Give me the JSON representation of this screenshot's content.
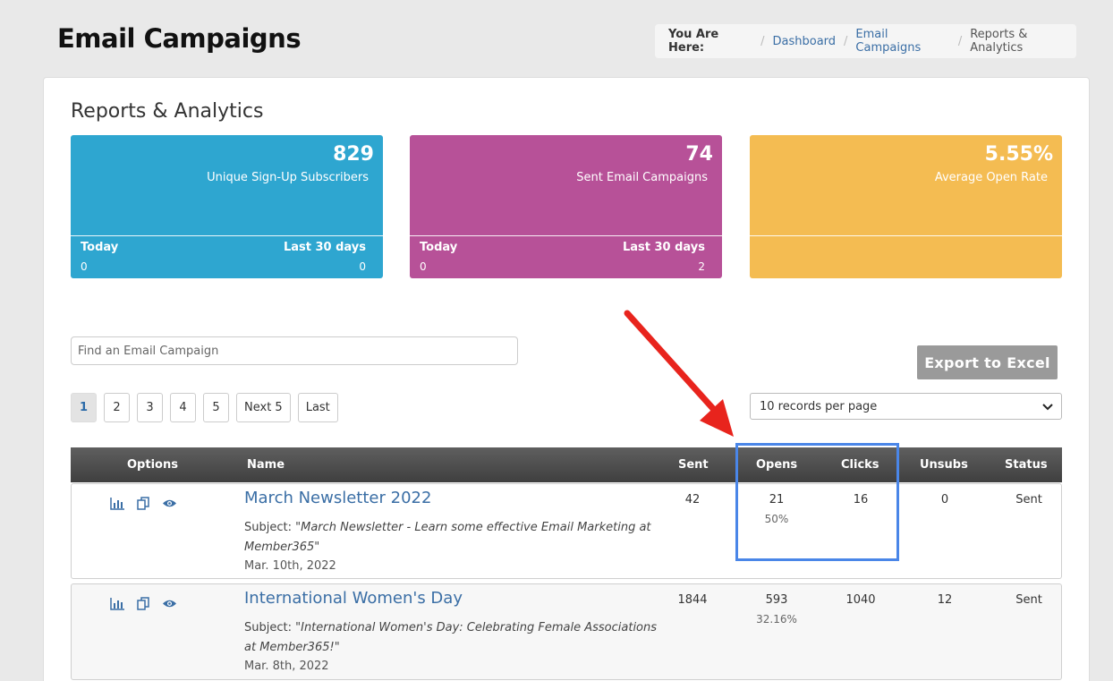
{
  "page": {
    "title": "Email Campaigns"
  },
  "breadcrumb": {
    "lead": "You Are Here:",
    "items": [
      "Dashboard",
      "Email Campaigns"
    ],
    "current": "Reports & Analytics"
  },
  "section": {
    "title": "Reports & Analytics"
  },
  "stats": [
    {
      "value": "829",
      "label": "Unique Sign-Up Subscribers",
      "today_label": "Today",
      "last30_label": "Last 30 days",
      "today": "0",
      "last30": "0",
      "color": "#2ea6d0"
    },
    {
      "value": "74",
      "label": "Sent Email Campaigns",
      "today_label": "Today",
      "last30_label": "Last 30 days",
      "today": "0",
      "last30": "2",
      "color": "#b75198"
    },
    {
      "value": "5.55%",
      "label": "Average Open Rate",
      "color": "#f4bc52"
    }
  ],
  "search": {
    "placeholder": "Find an Email Campaign"
  },
  "export": {
    "label": "Export to Excel"
  },
  "pagination": {
    "pages": [
      "1",
      "2",
      "3",
      "4",
      "5"
    ],
    "next": "Next 5",
    "last": "Last",
    "active": "1"
  },
  "per_page": {
    "selected": "10 records per page"
  },
  "table": {
    "headers": {
      "options": "Options",
      "name": "Name",
      "sent": "Sent",
      "opens": "Opens",
      "clicks": "Clicks",
      "unsubs": "Unsubs",
      "status": "Status"
    },
    "rows": [
      {
        "name": "March Newsletter 2022",
        "subject_label": "Subject:",
        "subject": "\"March Newsletter - Learn some effective Email Marketing at Member365\"",
        "date": "Mar. 10th, 2022",
        "sent": "42",
        "opens": "21",
        "open_pct": "50%",
        "clicks": "16",
        "unsubs": "0",
        "status": "Sent"
      },
      {
        "name": "International Women's Day",
        "subject_label": "Subject:",
        "subject": "\"International Women's Day: Celebrating Female Associations at Member365!\"",
        "date": "Mar. 8th, 2022",
        "sent": "1844",
        "opens": "593",
        "open_pct": "32.16%",
        "clicks": "1040",
        "unsubs": "12",
        "status": "Sent"
      }
    ]
  },
  "annotation": {
    "arrow_color": "#e8241d",
    "box_color": "#4a86e8"
  },
  "icons": [
    "report-icon",
    "copy-icon",
    "view-icon",
    "chevron-down-icon"
  ]
}
